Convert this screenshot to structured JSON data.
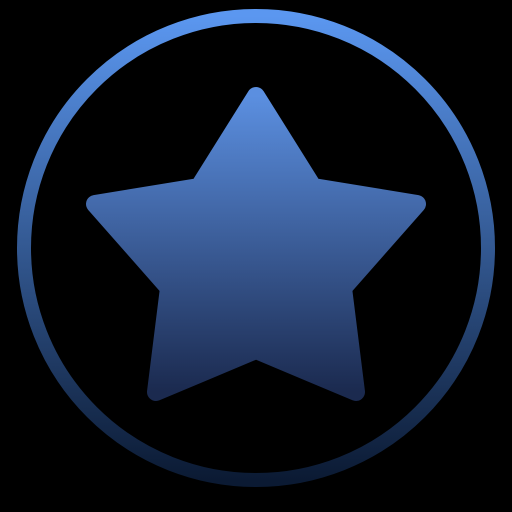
{
  "icon": {
    "name": "star-icon",
    "description_visible_text": "",
    "colors": {
      "background": "#000000",
      "ring_top": "#5B97F0",
      "ring_bottom": "#0B1A33",
      "star_top": "#5B8FE0",
      "star_bottom": "#1B2A4F"
    }
  }
}
